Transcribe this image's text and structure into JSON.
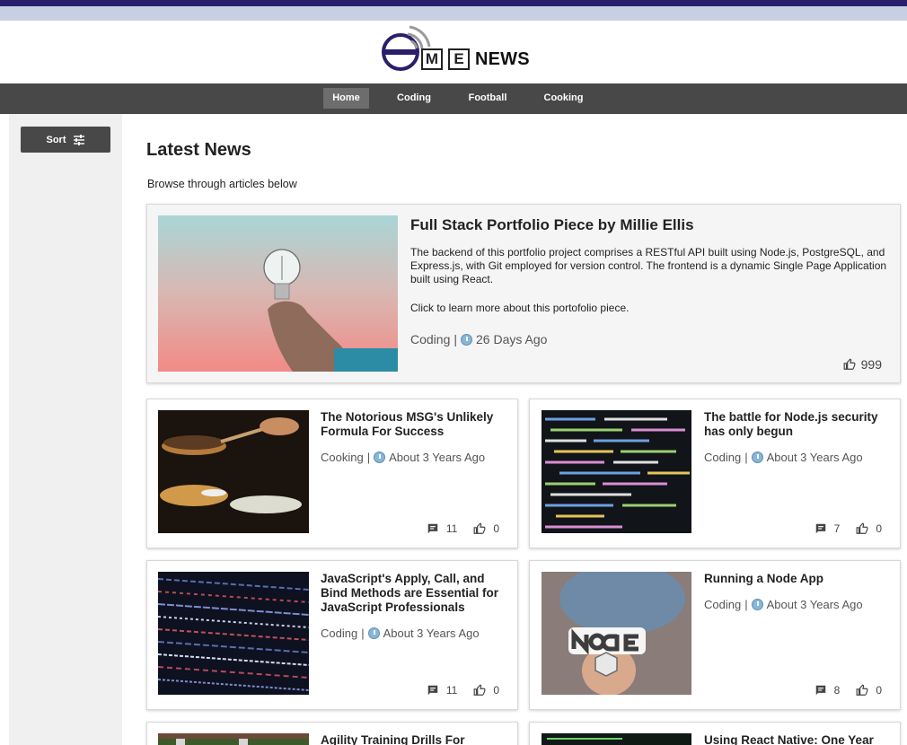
{
  "brand": {
    "letter_m": "M",
    "letter_e": "E",
    "news": "NEWS"
  },
  "nav": {
    "items": [
      {
        "label": "Home",
        "active": true
      },
      {
        "label": "Coding",
        "active": false
      },
      {
        "label": "Football",
        "active": false
      },
      {
        "label": "Cooking",
        "active": false
      }
    ]
  },
  "sidebar": {
    "sort_label": "Sort"
  },
  "main": {
    "heading": "Latest News",
    "subheading": "Browse through articles below"
  },
  "featured": {
    "title": "Full Stack Portfolio Piece by Millie Ellis",
    "body": "The backend of this portfolio project comprises a RESTful API built using Node.js, PostgreSQL, and Express.js, with Git employed for version control. The frontend is a dynamic Single Page Application built using React.",
    "click_text": "Click to learn more about this portofolio piece.",
    "topic": "Coding",
    "separator": "|",
    "age": "26 Days Ago",
    "likes": "999"
  },
  "articles": [
    {
      "title": "The Notorious MSG's Unlikely Formula For Success",
      "topic": "Cooking",
      "separator": "|",
      "age": "About 3 Years Ago",
      "comments": "11",
      "likes": "0"
    },
    {
      "title": "The battle for Node.js security has only begun",
      "topic": "Coding",
      "separator": "|",
      "age": "About 3 Years Ago",
      "comments": "7",
      "likes": "0"
    },
    {
      "title": "JavaScript's Apply, Call, and Bind Methods are Essential for JavaScript Professionals",
      "topic": "Coding",
      "separator": "|",
      "age": "About 3 Years Ago",
      "comments": "11",
      "likes": "0"
    },
    {
      "title": "Running a Node App",
      "topic": "Coding",
      "separator": "|",
      "age": "About 3 Years Ago",
      "comments": "8",
      "likes": "0"
    },
    {
      "title": "Agility Training Drills For",
      "topic": "",
      "separator": "",
      "age": "",
      "comments": "",
      "likes": ""
    },
    {
      "title": "Using React Native: One Year",
      "topic": "",
      "separator": "",
      "age": "",
      "comments": "",
      "likes": ""
    }
  ],
  "colors": {
    "top_band": "#2a1f6b",
    "top_band_light": "#c7d0e2",
    "nav_bg": "#484848",
    "nav_active": "#6d6d6d",
    "sidebar_bg": "#f0f0f0",
    "logo_blue": "#2a1f6b"
  },
  "icons": {
    "sort": "sliders-icon",
    "clock": "clock-icon",
    "comment": "comment-icon",
    "like": "thumbs-up-icon"
  }
}
